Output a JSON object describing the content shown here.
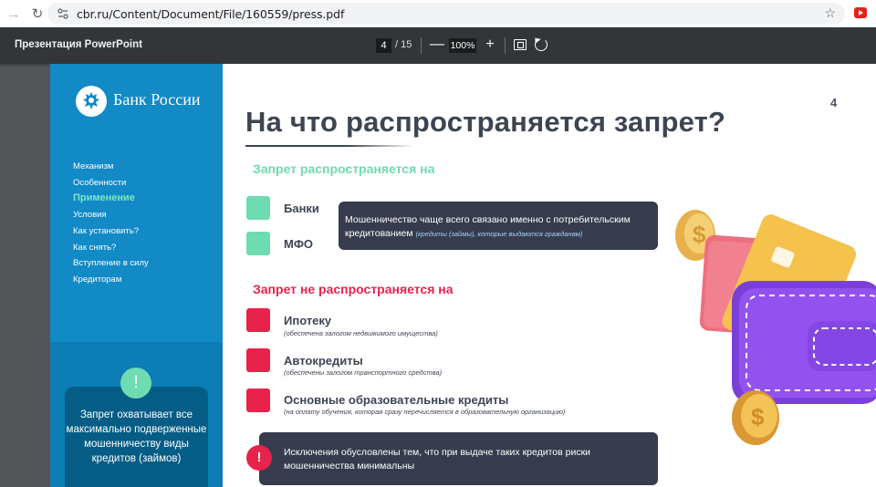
{
  "browser": {
    "url": "cbr.ru/Content/Document/File/160559/press.pdf",
    "back_icon": "arrow-left-icon",
    "reload_icon": "reload-icon",
    "bookmark_icon": "star-icon"
  },
  "pdf_toolbar": {
    "title": "Презентация PowerPoint",
    "current_page": "4",
    "page_total": "/ 15",
    "zoom": "100%",
    "zoom_out": "—",
    "zoom_in": "+"
  },
  "sidebar": {
    "bank_name": "Банк России",
    "menu": [
      {
        "label": "Механизм",
        "active": false
      },
      {
        "label": "Особенности",
        "active": false
      },
      {
        "label": "Применение",
        "active": true
      },
      {
        "label": "Условия",
        "active": false
      },
      {
        "label": "Как установить?",
        "active": false
      },
      {
        "label": "Как снять?",
        "active": false
      },
      {
        "label": "Вступление в силу",
        "active": false
      },
      {
        "label": "Кредиторам",
        "active": false
      }
    ],
    "info_badge": "!",
    "info_text": "Запрет охватывает все максимально подверженные мошенничеству виды кредитов (займов)"
  },
  "slide": {
    "number": "4",
    "title": "На что распространяется запрет?",
    "applies_heading": "Запрет распространяется на",
    "applies_items": [
      {
        "label": "Банки"
      },
      {
        "label": "МФО"
      }
    ],
    "callout_top": {
      "text": "Мошенничество чаще всего связано именно с потребительским кредитованием",
      "note": "(кредиты (займы), которые выдаются гражданам)"
    },
    "not_applies_heading": "Запрет не распространяется на",
    "not_applies_items": [
      {
        "label": "Ипотеку",
        "note": "(обеспечена залогом недвижимого имущества)"
      },
      {
        "label": "Автокредиты",
        "note": "(обеспечены залогом транспортного средства)"
      },
      {
        "label": "Основные образовательные кредиты",
        "note": "(на оплату обучения, которая сразу перечисляется в образовательную организацию)"
      }
    ],
    "warn_badge": "!",
    "callout_bottom": "Исключения обусловлены тем, что при выдаче таких кредитов риски мошенничества минимальны"
  },
  "colors": {
    "sidebar_blue": "#118ac6",
    "accent_green": "#6fdbb0",
    "accent_red": "#e8234b",
    "callout_dark": "#363c4d",
    "title_gray": "#3e4552"
  }
}
